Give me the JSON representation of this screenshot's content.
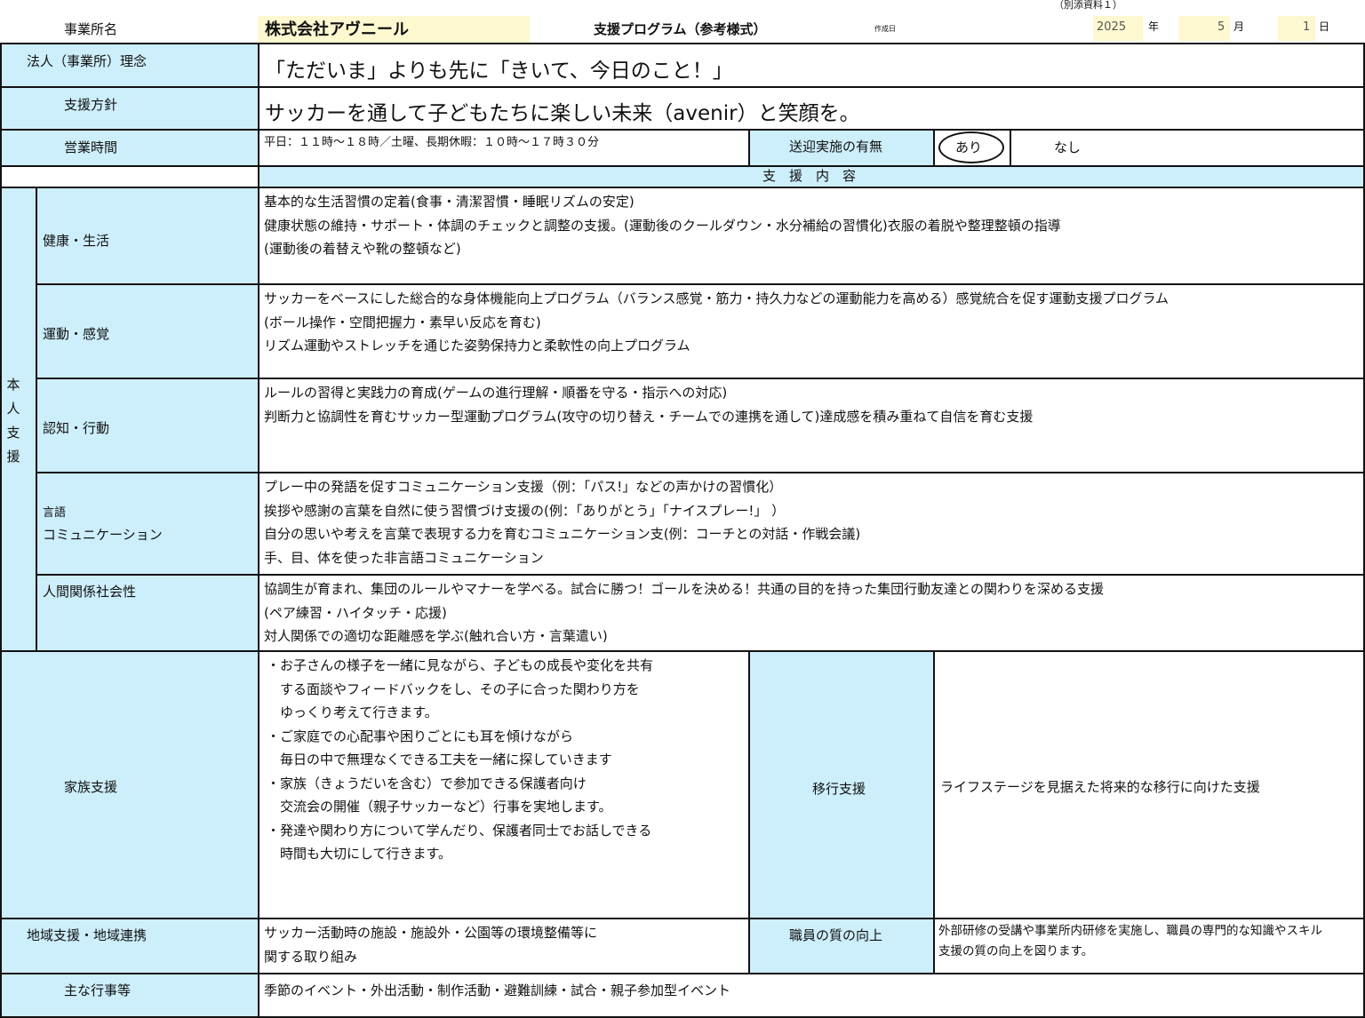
{
  "header": {
    "attachment_note": "（別添資料１）",
    "office_label": "事業所名",
    "office_name": "株式会社アヴニール",
    "program_title": "支援プログラム（参考様式）",
    "created_label": "作成日",
    "year_value": "2025",
    "year_unit": "年",
    "month_value": "5",
    "month_unit": "月",
    "day_value": "1",
    "day_unit": "日"
  },
  "philosophy": {
    "label": "法人（事業所）理念",
    "value": "「ただいま」よりも先に「きいて、今日のこと！」"
  },
  "policy": {
    "label": "支援方針",
    "value": "サッカーを通して子どもたちに楽しい未来（avenir）と笑顔を。"
  },
  "hours": {
    "label": "営業時間",
    "value": "平日：１１時～１８時／土曜、長期休暇：１０時～１７時３０分",
    "transport_label": "送迎実施の有無",
    "option_yes": "あり",
    "option_no": "なし",
    "selected": "あり"
  },
  "support_content": {
    "header": "支　援　内　容",
    "vertical_label": [
      "本",
      "人",
      "支",
      "援"
    ],
    "domains": [
      {
        "label": "健康・生活",
        "lines": [
          "基本的な生活習慣の定着(食事・清潔習慣・睡眠リズムの安定)",
          "健康状態の維持・サポート・体調のチェックと調整の支援。(運動後のクールダウン・水分補給の習慣化)衣服の着脱や整理整頓の指導",
          "(運動後の着替えや靴の整頓など)"
        ]
      },
      {
        "label": "運動・感覚",
        "lines": [
          "サッカーをベースにした総合的な身体機能向上プログラム（バランス感覚・筋力・持久力などの運動能力を高める）感覚統合を促す運動支援プログラム",
          "(ボール操作・空間把握力・素早い反応を育む)",
          "リズム運動やストレッチを通じた姿勢保持力と柔軟性の向上プログラム"
        ]
      },
      {
        "label": "認知・行動",
        "lines": [
          "ルールの習得と実践力の育成(ゲームの進行理解・順番を守る・指示への対応)",
          "判断力と協調性を育むサッカー型運動プログラム(攻守の切り替え・チームでの連携を通して)達成感を積み重ねて自信を育む支援"
        ]
      },
      {
        "label_line1": "言語",
        "label_line2": "コミュニケーション",
        "lines": [
          "プレー中の発語を促すコミュニケーション支援（例：「パス!」などの声かけの習慣化）",
          "挨拶や感謝の言葉を自然に使う習慣づけ支援の(例：「ありがとう」「ナイスプレー!」 ）",
          "自分の思いや考えを言葉で表現する力を育むコミュニケーション支(例：コーチとの対話・作戦会議)",
          "手、目、体を使った非言語コミュニケーション"
        ]
      },
      {
        "label": "人間関係社会性",
        "lines": [
          "協調生が育まれ、集団のルールやマナーを学べる。試合に勝つ！ゴールを決める！共通の目的を持った集団行動友達との関わりを深める支援",
          "(ペア練習・ハイタッチ・応援)",
          "対人関係での適切な距離感を学ぶ(触れ合い方・言葉遣い)"
        ]
      }
    ]
  },
  "family": {
    "label": "家族支援",
    "lines": [
      "・お子さんの様子を一緒に見ながら、子どもの成長や変化を共有",
      "　する面談やフィードバックをし、その子に合った関わり方を",
      "　ゆっくり考えて行きます。",
      "・ご家庭での心配事や困りごとにも耳を傾けながら",
      "　毎日の中で無理なくできる工夫を一緒に探していきます",
      "・家族（きょうだいを含む）で参加できる保護者向け",
      "　交流会の開催（親子サッカーなど）行事を実地します。",
      "・発達や関わり方について学んだり、保護者同士でお話しできる",
      "　時間も大切にして行きます。"
    ]
  },
  "transition": {
    "label": "移行支援",
    "value": "ライフステージを見据えた将来的な移行に向けた支援"
  },
  "community": {
    "label": "地域支援・地域連携",
    "lines": [
      "サッカー活動時の施設・施設外・公園等の環境整備等に",
      "関する取り組み"
    ]
  },
  "staff": {
    "label": "職員の質の向上",
    "lines": [
      "外部研修の受講や事業所内研修を実施し、職員の専門的な知識やスキル",
      "支援の質の向上を図ります。"
    ]
  },
  "events": {
    "label": "主な行事等",
    "value": "季節のイベント・外出活動・制作活動・避難訓練・試合・親子参加型イベント"
  },
  "colors": {
    "label_bg": "#cdeefb",
    "highlight_bg": "#fdf8d0",
    "border": "#111111"
  }
}
